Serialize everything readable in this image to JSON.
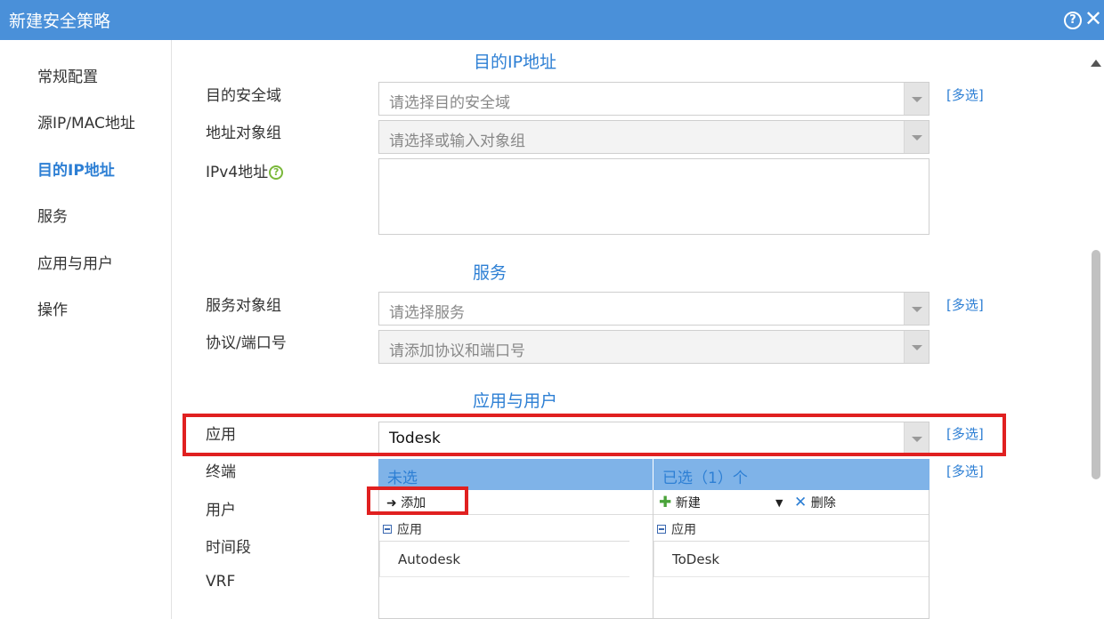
{
  "window": {
    "title": "新建安全策略",
    "help_glyph": "?",
    "close_glyph": "✕"
  },
  "sidebar": {
    "items": [
      {
        "label": "常规配置",
        "active": false
      },
      {
        "label": "源IP/MAC地址",
        "active": false
      },
      {
        "label": "目的IP地址",
        "active": true
      },
      {
        "label": "服务",
        "active": false
      },
      {
        "label": "应用与用户",
        "active": false
      },
      {
        "label": "操作",
        "active": false
      }
    ]
  },
  "dest_ip": {
    "section_title": "目的IP地址",
    "zone_label": "目的安全域",
    "zone_placeholder": "请选择目的安全域",
    "group_label": "地址对象组",
    "group_placeholder": "请选择或输入对象组",
    "ipv4_label": "IPv4地址",
    "ipv4_help": "?",
    "multi_label": "[多选]"
  },
  "service": {
    "section_title": "服务",
    "group_label": "服务对象组",
    "group_placeholder": "请选择服务",
    "proto_label": "协议/端口号",
    "proto_placeholder": "请添加协议和端口号",
    "multi_label": "[多选]"
  },
  "app_user": {
    "section_title": "应用与用户",
    "app_label": "应用",
    "app_value": "Todesk",
    "app_multi_label": "[多选]",
    "terminal_label": "终端",
    "terminal_multi_label": "[多选]",
    "user_label": "用户",
    "time_label": "时间段",
    "vrf_label": "VRF"
  },
  "picker": {
    "unselected_title": "未选",
    "selected_title": "已选（1）个",
    "add_label": "添加",
    "new_label": "新建",
    "delete_label": "删除",
    "unselected_group": "应用",
    "selected_group": "应用",
    "unselected_items": [
      "Autodesk"
    ],
    "selected_items": [
      "ToDesk"
    ]
  },
  "colors": {
    "titlebar": "#4a90d9",
    "accent": "#2d7fd4",
    "highlight": "#e02020",
    "panel_header": "#7fb3e8"
  }
}
